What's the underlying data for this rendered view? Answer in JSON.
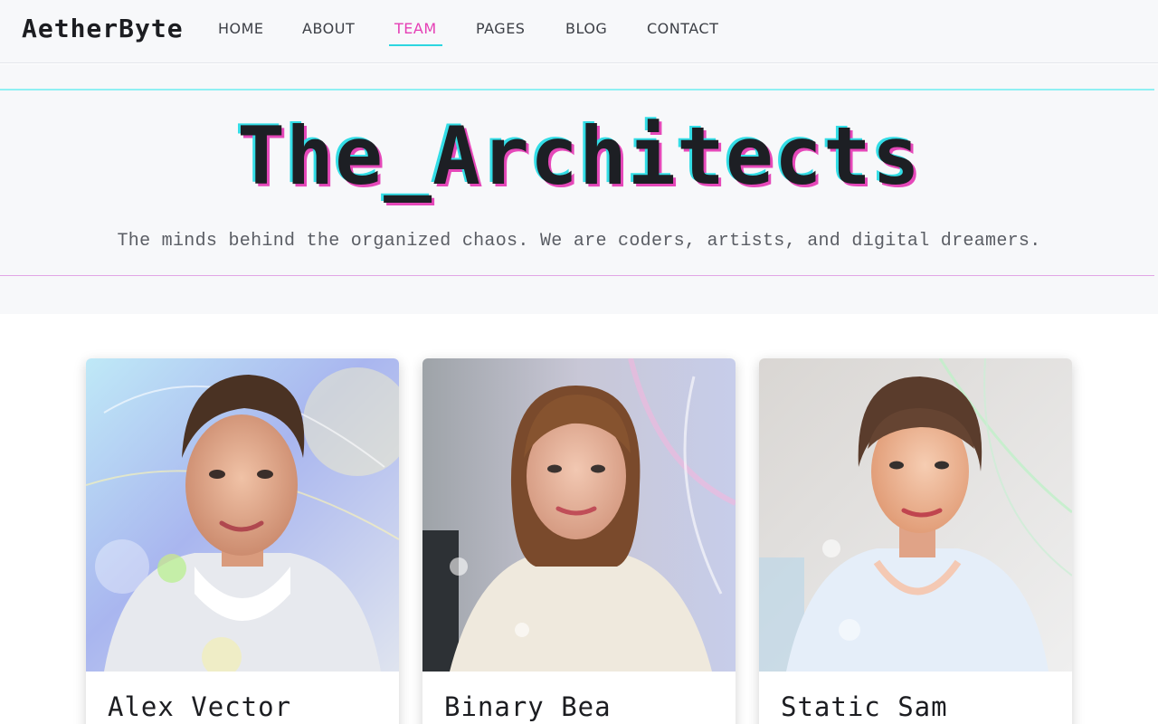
{
  "brand": {
    "logo": "AetherByte"
  },
  "nav": {
    "items": [
      {
        "label": "HOME",
        "active": false
      },
      {
        "label": "ABOUT",
        "active": false
      },
      {
        "label": "TEAM",
        "active": true
      },
      {
        "label": "PAGES",
        "active": false
      },
      {
        "label": "BLOG",
        "active": false
      },
      {
        "label": "CONTACT",
        "active": false
      }
    ]
  },
  "hero": {
    "title": "The_Architects",
    "subtitle": "The minds behind the organized chaos. We are coders, artists, and digital dreamers."
  },
  "team": {
    "members": [
      {
        "name": "Alex Vector",
        "photo": "portrait-man-hoodie"
      },
      {
        "name": "Binary Bea",
        "photo": "portrait-woman-hoodie"
      },
      {
        "name": "Static Sam",
        "photo": "portrait-woman-hoodie-updo"
      }
    ]
  },
  "colors": {
    "accent_magenta": "#e53fb5",
    "accent_cyan": "#2dd6e0",
    "text_dark": "#1c1d21"
  }
}
